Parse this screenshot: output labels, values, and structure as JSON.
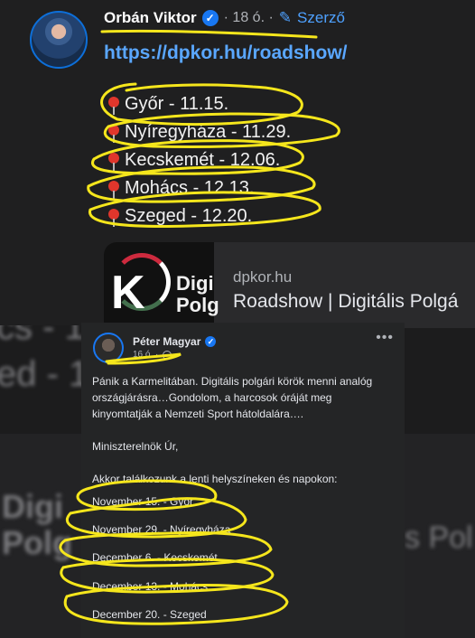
{
  "background": {
    "ghost_lines": [
      "cs - 1",
      "ed - 1"
    ],
    "ghost_card_text": [
      "Digi",
      "Polg",
      "s Pol"
    ]
  },
  "post1": {
    "author": "Orbán Viktor",
    "age": "· 18 ó. ·",
    "author_tag": "Szerző",
    "link": "https://dpkor.hu/roadshow/",
    "schedule": [
      "Győr - 11.15.",
      "Nyíregyháza - 11.29.",
      "Kecskemét - 12.06.",
      "Mohács - 12.13.",
      "Szeged - 12.20."
    ],
    "card": {
      "logo_letter": "K",
      "logo_text_1": "Digi",
      "logo_text_2": "Polg",
      "domain": "dpkor.hu",
      "title": "Roadshow | Digitális Polgá"
    }
  },
  "post2": {
    "author": "Péter Magyar",
    "age": "16 ó. ·",
    "more": "•••",
    "paragraph": "Pánik a Karmelitában. Digitális polgári körök menni analóg országjárásra…Gondolom, a harcosok óráját meg kinyomtatják a Nemzeti Sport hátoldalára….",
    "salutation": "Miniszterelnök Úr,",
    "intro": "Akkor találkozunk a lenti helyszíneken és napokon:",
    "dates": [
      "November 15. - Győr",
      "November 29. - Nyíregyháza",
      "December 6. - Kecskemét",
      "December 13. - Mohács",
      "December 20. - Szeged"
    ]
  },
  "colors": {
    "link": "#5aa7ff",
    "verified": "#1877f2",
    "highlight": "#f5e61c",
    "pin": "#e0362c"
  }
}
